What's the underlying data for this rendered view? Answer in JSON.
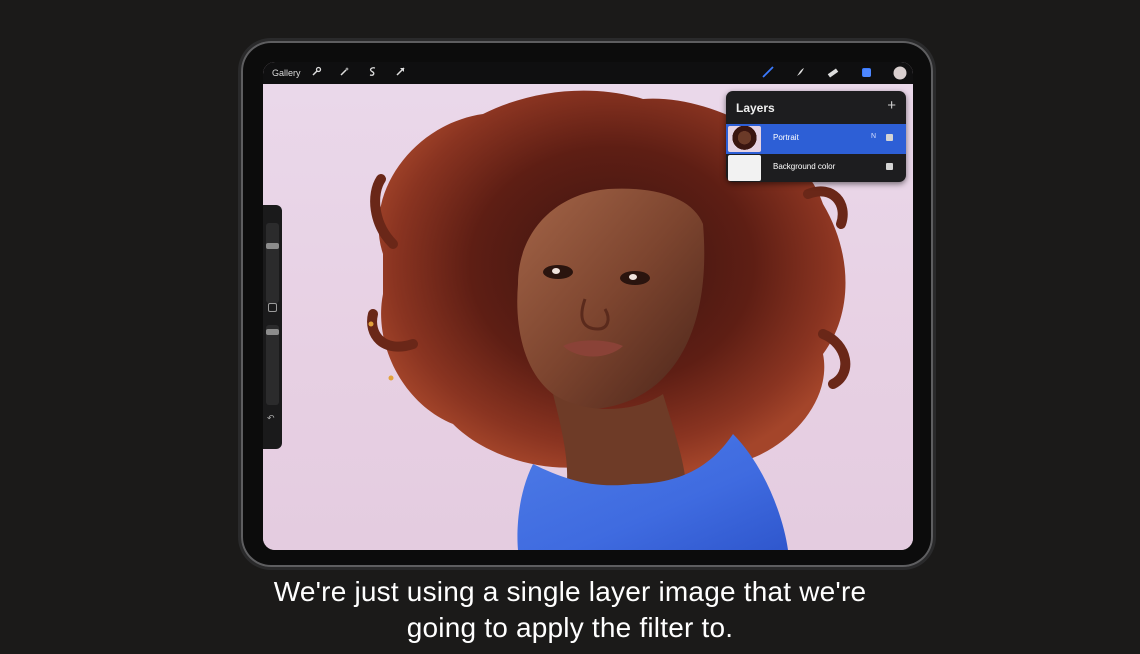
{
  "toolbar": {
    "gallery_label": "Gallery",
    "left_tools": [
      "wrench-icon",
      "magic-wand-icon",
      "selection-s-icon",
      "arrow-transform-icon"
    ],
    "right_tools": [
      "brush-icon",
      "smudge-icon",
      "eraser-icon",
      "layers-icon",
      "color-swatch"
    ],
    "accent": "#3b7bff"
  },
  "layers_panel": {
    "title": "Layers",
    "add_label": "+",
    "layers": [
      {
        "name": "Portrait",
        "blend": "N",
        "visible": true,
        "selected": true
      },
      {
        "name": "Background color",
        "visible": true,
        "selected": false
      }
    ]
  },
  "sidebar": {
    "undo_label": "↶"
  },
  "caption": {
    "line1": "We're just using a single layer image that we're",
    "line2": "going to apply the filter to."
  }
}
